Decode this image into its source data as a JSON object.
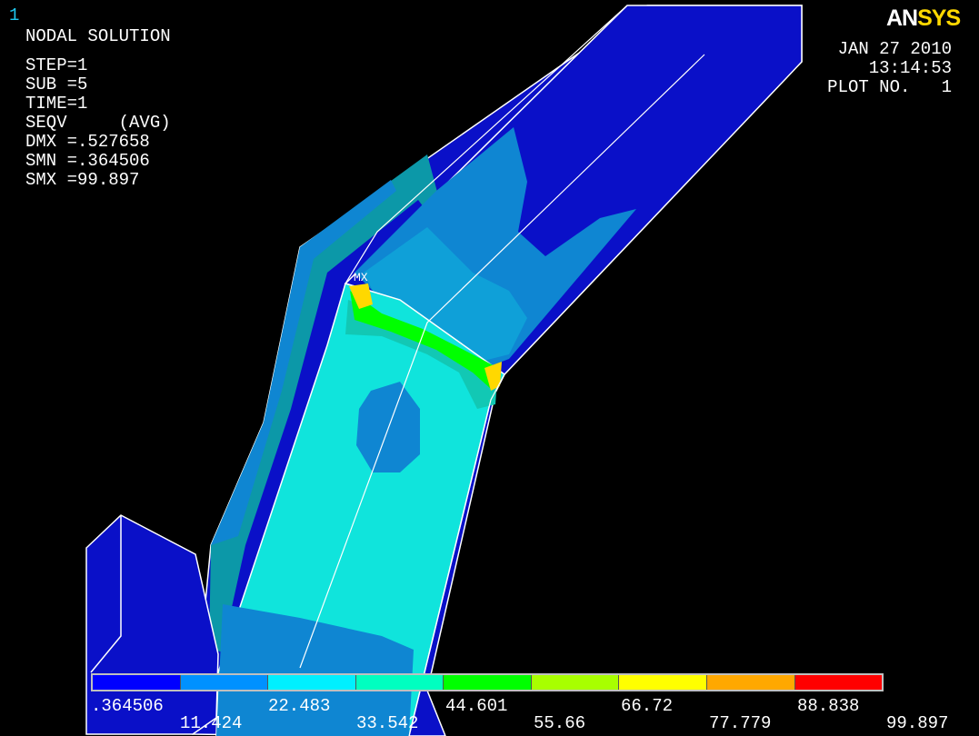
{
  "window_number": "1",
  "logo": {
    "part1": "AN",
    "part2": "SYS"
  },
  "header": {
    "title": "NODAL SOLUTION",
    "lines": [
      "STEP=1",
      "SUB =5",
      "TIME=1",
      "SEQV     (AVG)",
      "DMX =.527658",
      "SMN =.364506",
      "SMX =99.897"
    ]
  },
  "plot_info": {
    "date": "JAN 27 2010",
    "time": "13:14:53",
    "plot_no": "PLOT NO.   1"
  },
  "max_marker": "MX",
  "legend": {
    "colors": [
      "#0000ff",
      "#0091ff",
      "#00f0ff",
      "#00ffc0",
      "#00ff00",
      "#a8ff00",
      "#ffff00",
      "#ffa800",
      "#ff0000"
    ],
    "labels_top": [
      ".364506",
      "22.483",
      "44.601",
      "66.72",
      "88.838"
    ],
    "labels_bottom": [
      "11.424",
      "33.542",
      "55.66",
      "77.779",
      "99.897"
    ]
  },
  "fill_colors": {
    "dark_blue": "#0a10c8",
    "mid_blue": "#0f86d2",
    "light_blue": "#0fa0d8",
    "cyan": "#10e4dc",
    "aqua": "#12c8b4",
    "teal": "#0c98a8"
  }
}
